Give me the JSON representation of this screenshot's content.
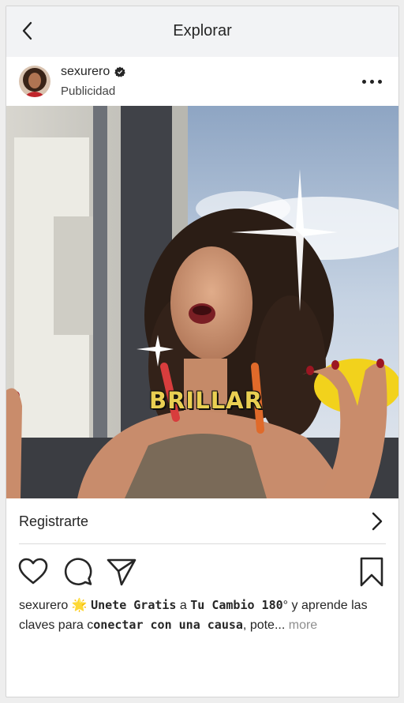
{
  "topbar": {
    "title": "Explorar",
    "back_icon": "chevron-left-icon"
  },
  "post": {
    "username": "sexurero",
    "verified": true,
    "sponsored_label": "Publicidad",
    "options_icon": "ellipsis-icon",
    "media": {
      "overlay_text": "BRILLAR"
    },
    "cta": {
      "label": "Registrarte",
      "icon": "chevron-right-icon"
    },
    "actions": {
      "like_icon": "heart-icon",
      "comment_icon": "comment-icon",
      "share_icon": "send-icon",
      "save_icon": "bookmark-icon"
    },
    "caption": {
      "username": "sexurero",
      "emoji": "🌟",
      "part1": "Unete Gratis",
      "part2": " a ",
      "part3": "Tu Cambio 180",
      "part4": "° y aprende las claves para c",
      "part5": "onectar con una causa",
      "part6": ", pote...",
      "more_label": "more"
    }
  },
  "colors": {
    "topbar_bg": "#f2f3f5",
    "text": "#262626",
    "muted": "#8e8e8e",
    "overlay_yellow": "#e9cf52"
  }
}
